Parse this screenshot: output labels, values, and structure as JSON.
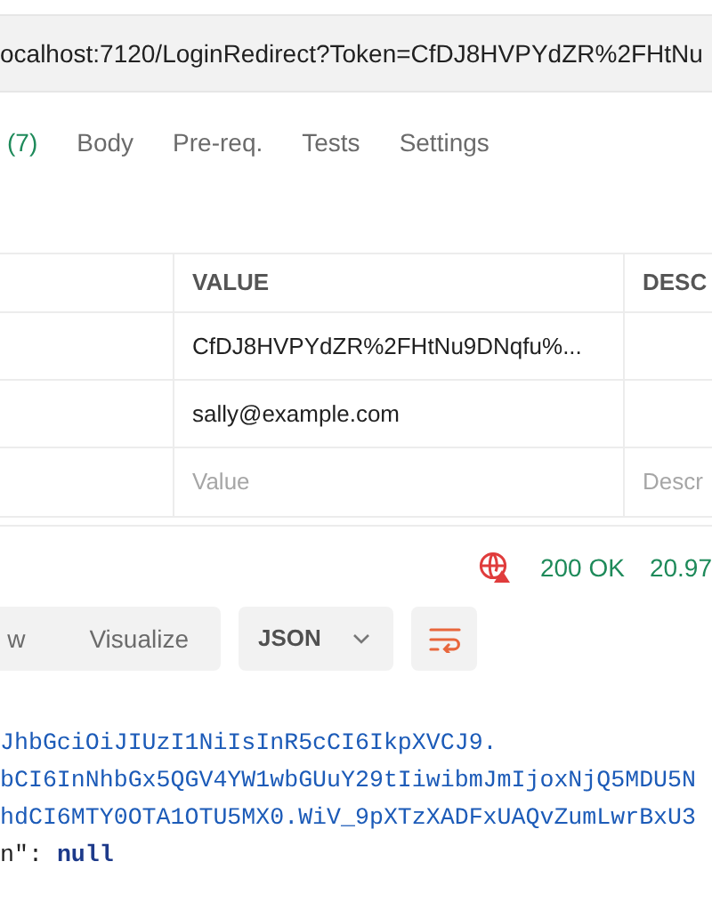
{
  "url": "ocalhost:7120/LoginRedirect?Token=CfDJ8HVPYdZR%2FHtNu",
  "request_tabs": [
    {
      "label": "(7)",
      "kind": "count"
    },
    {
      "label": "Body",
      "kind": "tab"
    },
    {
      "label": "Pre-req.",
      "kind": "tab"
    },
    {
      "label": "Tests",
      "kind": "tab"
    },
    {
      "label": "Settings",
      "kind": "tab"
    }
  ],
  "params_table": {
    "columns": [
      "VALUE",
      "DESC"
    ],
    "rows": [
      {
        "value": "CfDJ8HVPYdZR%2FHtNu9DNqfu%..."
      },
      {
        "value": "sally@example.com"
      },
      {
        "value_placeholder": "Value",
        "description_placeholder": "Descr"
      }
    ]
  },
  "response_status": {
    "status": "200 OK",
    "time": "20.97"
  },
  "view_modes": [
    "w",
    "Visualize"
  ],
  "format": "JSON",
  "code_lines": [
    [
      {
        "kind": "string",
        "text": "JhbGciOiJIUzI1NiIsInR5cCI6IkpXVCJ9."
      }
    ],
    [
      {
        "kind": "string",
        "text": "bCI6InNhbGx5QGV4YW1wbGUuY29tIiwibmJmIjoxNjQ5MDU5N"
      }
    ],
    [
      {
        "kind": "string",
        "text": "hdCI6MTY0OTA1OTU5MX0.WiV_9pXTzXADFxUAQvZumLwrBxU3"
      }
    ],
    [
      {
        "kind": "key",
        "text": "n\":"
      },
      {
        "kind": "null",
        "text": "null"
      }
    ]
  ]
}
